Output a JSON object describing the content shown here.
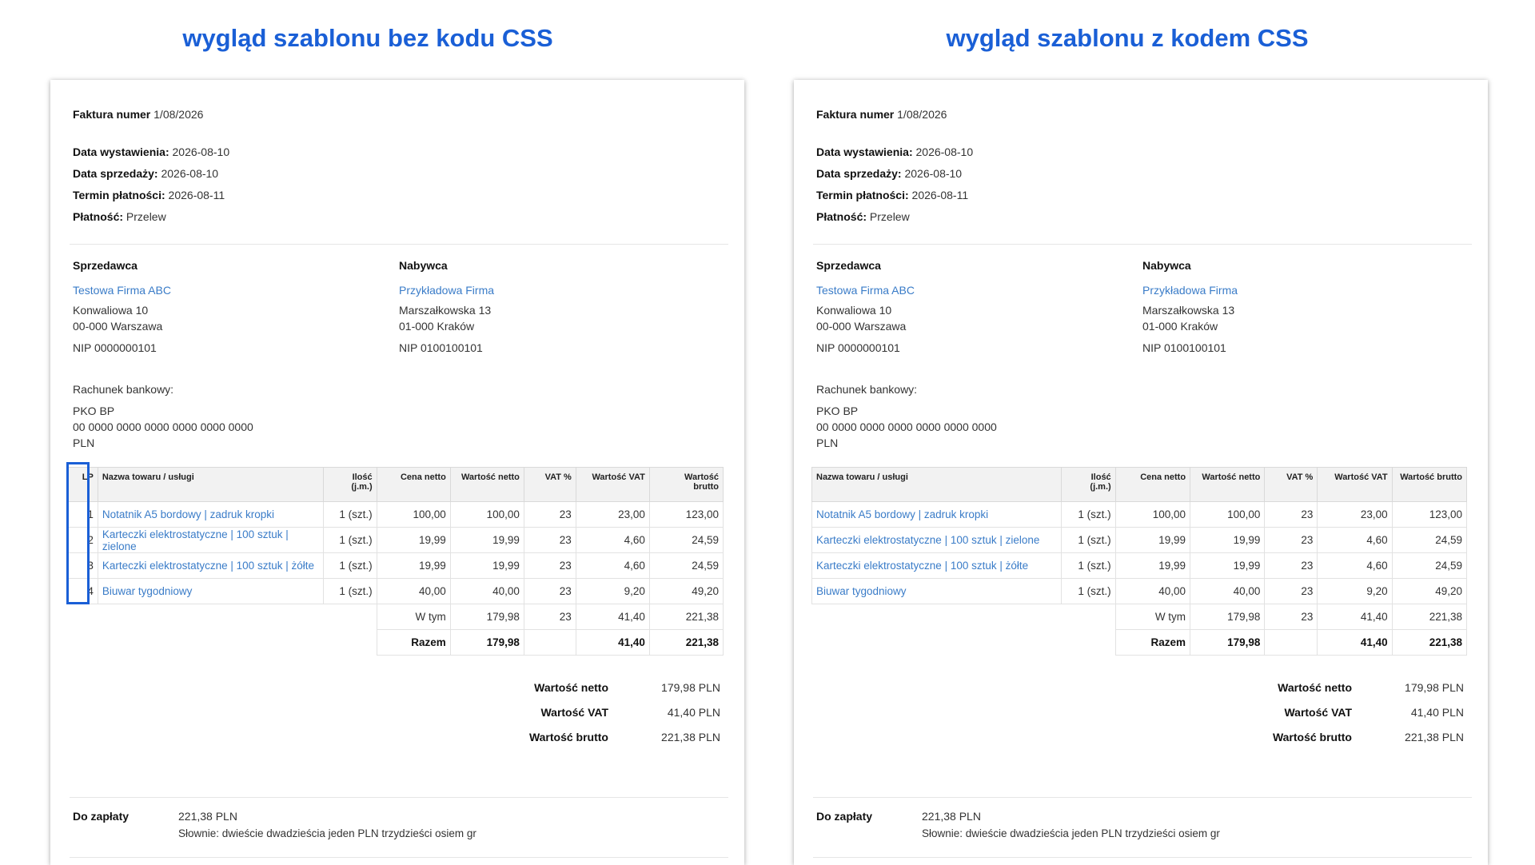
{
  "headings": {
    "left": "wygląd szablonu bez kodu CSS",
    "right": "wygląd szablonu z kodem CSS"
  },
  "invoice": {
    "number_label": "Faktura numer",
    "number": "1/08/2026",
    "issue_date_label": "Data wystawienia:",
    "issue_date": "2026-08-10",
    "sale_date_label": "Data sprzedaży:",
    "sale_date": "2026-08-10",
    "due_date_label": "Termin płatności:",
    "due_date": "2026-08-11",
    "payment_label": "Płatność:",
    "payment": "Przelew"
  },
  "seller": {
    "title": "Sprzedawca",
    "name": "Testowa Firma ABC",
    "street": "Konwaliowa 10",
    "city": "00-000 Warszawa",
    "nip": "NIP 0000000101"
  },
  "buyer": {
    "title": "Nabywca",
    "name": "Przykładowa Firma",
    "street": "Marszałkowska 13",
    "city": "01-000 Kraków",
    "nip": "NIP 0100100101"
  },
  "bank": {
    "label": "Rachunek bankowy:",
    "name": "PKO BP",
    "account": "00 0000 0000 0000 0000 0000 0000",
    "currency": "PLN"
  },
  "table": {
    "headers": {
      "lp": "LP",
      "name": "Nazwa towaru / usługi",
      "qty_line1": "Ilość",
      "qty_line2": "(j.m.)",
      "net_price": "Cena netto",
      "net_value": "Wartość netto",
      "vat_pct": "VAT %",
      "vat_value": "Wartość VAT",
      "gross_line1": "Wartość",
      "gross_line2": "brutto",
      "gross_full": "Wartość brutto"
    },
    "rows": [
      {
        "lp": "1",
        "name": "Notatnik A5 bordowy | zadruk kropki",
        "qty": "1 (szt.)",
        "net_price": "100,00",
        "net_value": "100,00",
        "vat_pct": "23",
        "vat_value": "23,00",
        "gross": "123,00"
      },
      {
        "lp": "2",
        "name": "Karteczki elektrostatyczne | 100 sztuk | zielone",
        "qty": "1 (szt.)",
        "net_price": "19,99",
        "net_value": "19,99",
        "vat_pct": "23",
        "vat_value": "4,60",
        "gross": "24,59"
      },
      {
        "lp": "3",
        "name": "Karteczki elektrostatyczne | 100 sztuk | żółte",
        "qty": "1 (szt.)",
        "net_price": "19,99",
        "net_value": "19,99",
        "vat_pct": "23",
        "vat_value": "4,60",
        "gross": "24,59"
      },
      {
        "lp": "4",
        "name": "Biuwar tygodniowy",
        "qty": "1 (szt.)",
        "net_price": "40,00",
        "net_value": "40,00",
        "vat_pct": "23",
        "vat_value": "9,20",
        "gross": "49,20"
      }
    ],
    "wtym": {
      "label": "W tym",
      "net_value": "179,98",
      "vat_pct": "23",
      "vat_value": "41,40",
      "gross": "221,38"
    },
    "razem": {
      "label": "Razem",
      "net_value": "179,98",
      "vat_value": "41,40",
      "gross": "221,38"
    }
  },
  "summary": [
    {
      "label": "Wartość netto",
      "value": "179,98 PLN"
    },
    {
      "label": "Wartość VAT",
      "value": "41,40 PLN"
    },
    {
      "label": "Wartość brutto",
      "value": "221,38 PLN"
    }
  ],
  "to_pay": {
    "label": "Do zapłaty",
    "amount": "221,38 PLN",
    "in_words": "Słownie: dwieście dwadzieścia jeden PLN trzydzieści osiem gr"
  },
  "colors": {
    "heading": "#1a5fd6",
    "link": "#3a7cc8",
    "highlight": "#1a5fd6"
  }
}
